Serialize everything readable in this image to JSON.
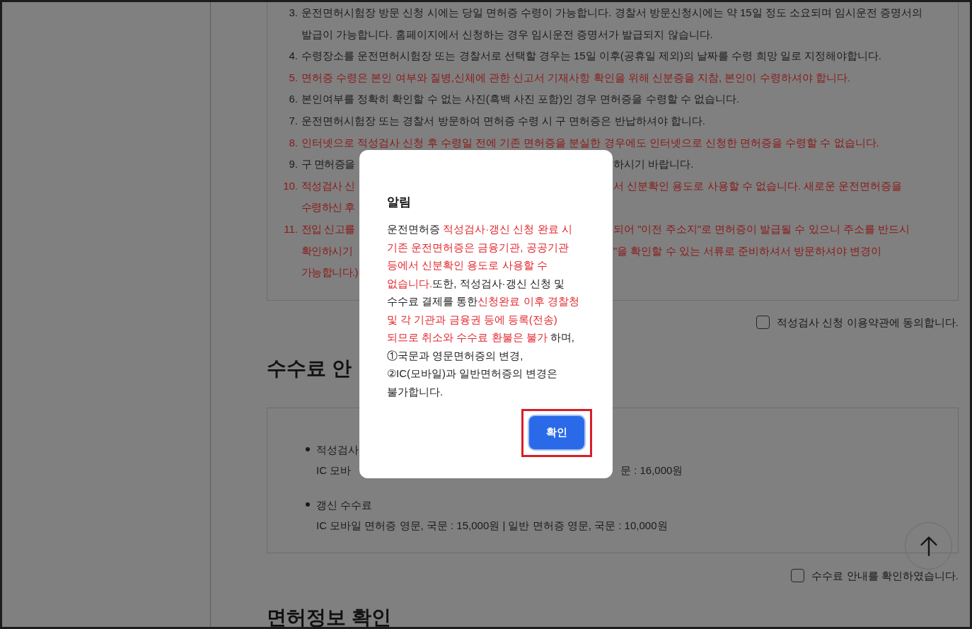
{
  "notice_items": [
    {
      "number": "3.",
      "warning": false,
      "lines": [
        [
          "운전면허시험장 방문 신청 시에는 당일 면허증 수령이 가능합니다. 경찰서 방문신청시에는 약 15일 정도 소요되며 임시운전 증명서의"
        ],
        [
          "발급이 가능합니다. 홈페이지에서 신청하는 경우 임시운전 증명서가 발급되지 않습니다."
        ]
      ]
    },
    {
      "number": "4.",
      "warning": false,
      "lines": [
        [
          "수령장소를 운전면허시험장 또는 경찰서로 선택할 경우는 15일 이후(공휴일 제외)의 날짜를 수령 희망 일로 지정해야합니다."
        ]
      ]
    },
    {
      "number": "5.",
      "warning": true,
      "lines": [
        [
          "면허증 수령은 본인 여부와 질병,신체에 관한 신고서 기재사항 확인을 위해 신분증을 지참, 본인이 수령하셔야 합니다."
        ]
      ]
    },
    {
      "number": "6.",
      "warning": false,
      "lines": [
        [
          "본인여부를 정확히 확인할 수 없는 사진(흑백 사진 포함)인 경우 면허증을 수령할 수 없습니다."
        ]
      ]
    },
    {
      "number": "7.",
      "warning": false,
      "lines": [
        [
          "운전면허시험장 또는 경찰서 방문하여 면허증 수령 시 구 면허증은 반납하셔야 합니다."
        ]
      ]
    },
    {
      "number": "8.",
      "warning": true,
      "lines": [
        [
          "인터넷으로 적성검사 신청 후 수령일 전에 기존 면허증을 분실한 경우에도 인터넷으로 신청한 면허증을 수령할 수 없습니다."
        ]
      ]
    },
    {
      "number": "9.",
      "warning": false,
      "lines": [
        [
          "구 면허증을",
          "하시기 바랍니다."
        ]
      ]
    },
    {
      "number": "10.",
      "warning": true,
      "lines": [
        [
          "적성검사 신",
          "서 신분확인 용도로 사용할 수 없습니다. 새로운 운전면허증을"
        ],
        [
          "수령하신 후"
        ]
      ]
    },
    {
      "number": "11.",
      "warning": true,
      "lines": [
        [
          "전입 신고를",
          "되어 \"이전 주소지\"로 면허증이 발급될 수 있으니 주소를 반드시"
        ],
        [
          "확인하시기",
          "\"을 확인할 수 있는 서류로 준비하셔서 방문하셔야 변경이"
        ],
        [
          "가능합니다.)"
        ]
      ]
    }
  ],
  "terms_agreement": {
    "label": "적성검사 신청 이용약관에 동의합니다.",
    "checked": false
  },
  "fee_section": {
    "heading": "수수료 안",
    "items": [
      {
        "title": [
          "적성검사"
        ],
        "detail": [
          "IC 모바",
          "문 : 16,000원"
        ]
      },
      {
        "title": [
          "갱신 수수료"
        ],
        "detail": [
          "IC 모바일 면허증 영문, 국문 : 15,000원 | 일반 면허증 영문, 국문 : 10,000원"
        ]
      }
    ],
    "agreement": {
      "label": "수수료 안내를 확인하였습니다.",
      "checked": false
    }
  },
  "next_heading": "면허정보 확인",
  "alert": {
    "title": "알림",
    "message": [
      [
        {
          "text": "운전면허증 ",
          "warning": false
        },
        {
          "text": "적성검사·갱신 신청 완료 시 기존 운전면허증은 금융기관, 공공기관 등에서 신분확인 용도로 사용할 수 없습니다.",
          "warning": true
        },
        {
          "text": "또한, 적성검사·갱신 신청 및 수수료 결제를 통한",
          "warning": false
        },
        {
          "text": "신청완료 이후 경찰청 및 각 기관과 금융권 등에 등록(전송) 되므로 취소와 수수료 환불은 불가",
          "warning": true
        },
        {
          "text": " 하며,",
          "warning": false
        }
      ],
      [
        {
          "text": "①국문과 영문면허증의 변경,",
          "warning": false
        }
      ],
      [
        {
          "text": "②IC(모바일)과 일반면허증의 변경은 불가합니다.",
          "warning": false
        }
      ]
    ],
    "confirm_button": "확인"
  }
}
